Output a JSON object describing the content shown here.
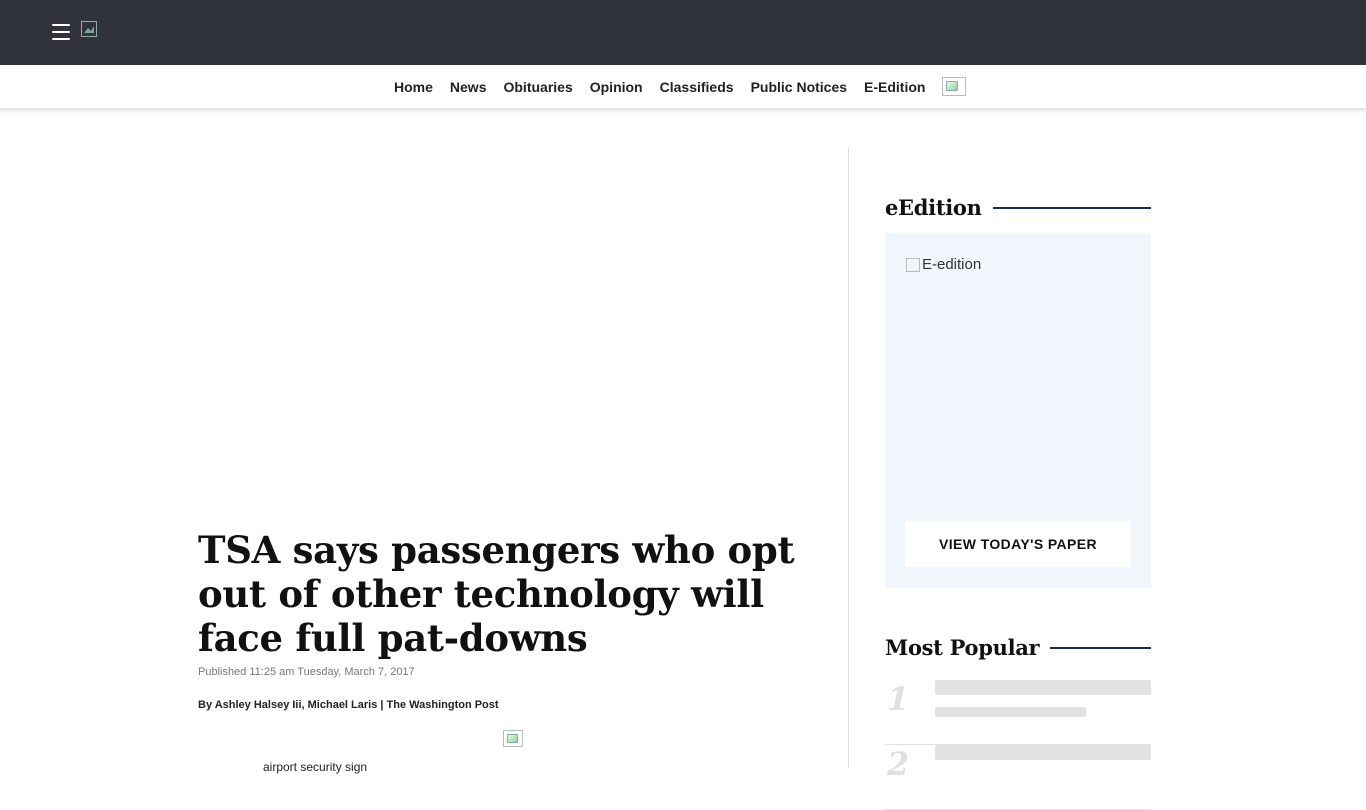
{
  "nav": {
    "items": [
      "Home",
      "News",
      "Obituaries",
      "Opinion",
      "Classifieds",
      "Public Notices",
      "E-Edition"
    ]
  },
  "article": {
    "headline": "TSA says passengers who opt out of other technology will face full pat-downs",
    "published": "Published 11:25 am Tuesday, March 7, 2017",
    "byline": "By Ashley Halsey Iii, Michael Laris | The Washington Post",
    "image_caption": "airport security sign"
  },
  "sidebar": {
    "eedition": {
      "title": "eEdition",
      "image_alt": "E-edition",
      "button_label": "VIEW TODAY'S PAPER"
    },
    "most_popular": {
      "title": "Most Popular",
      "items": [
        {
          "rank": "1"
        },
        {
          "rank": "2"
        }
      ]
    }
  },
  "colors": {
    "topbar": "#30333c",
    "accent_rule": "#14304d",
    "eedition_bg": "#f1f6fc"
  }
}
